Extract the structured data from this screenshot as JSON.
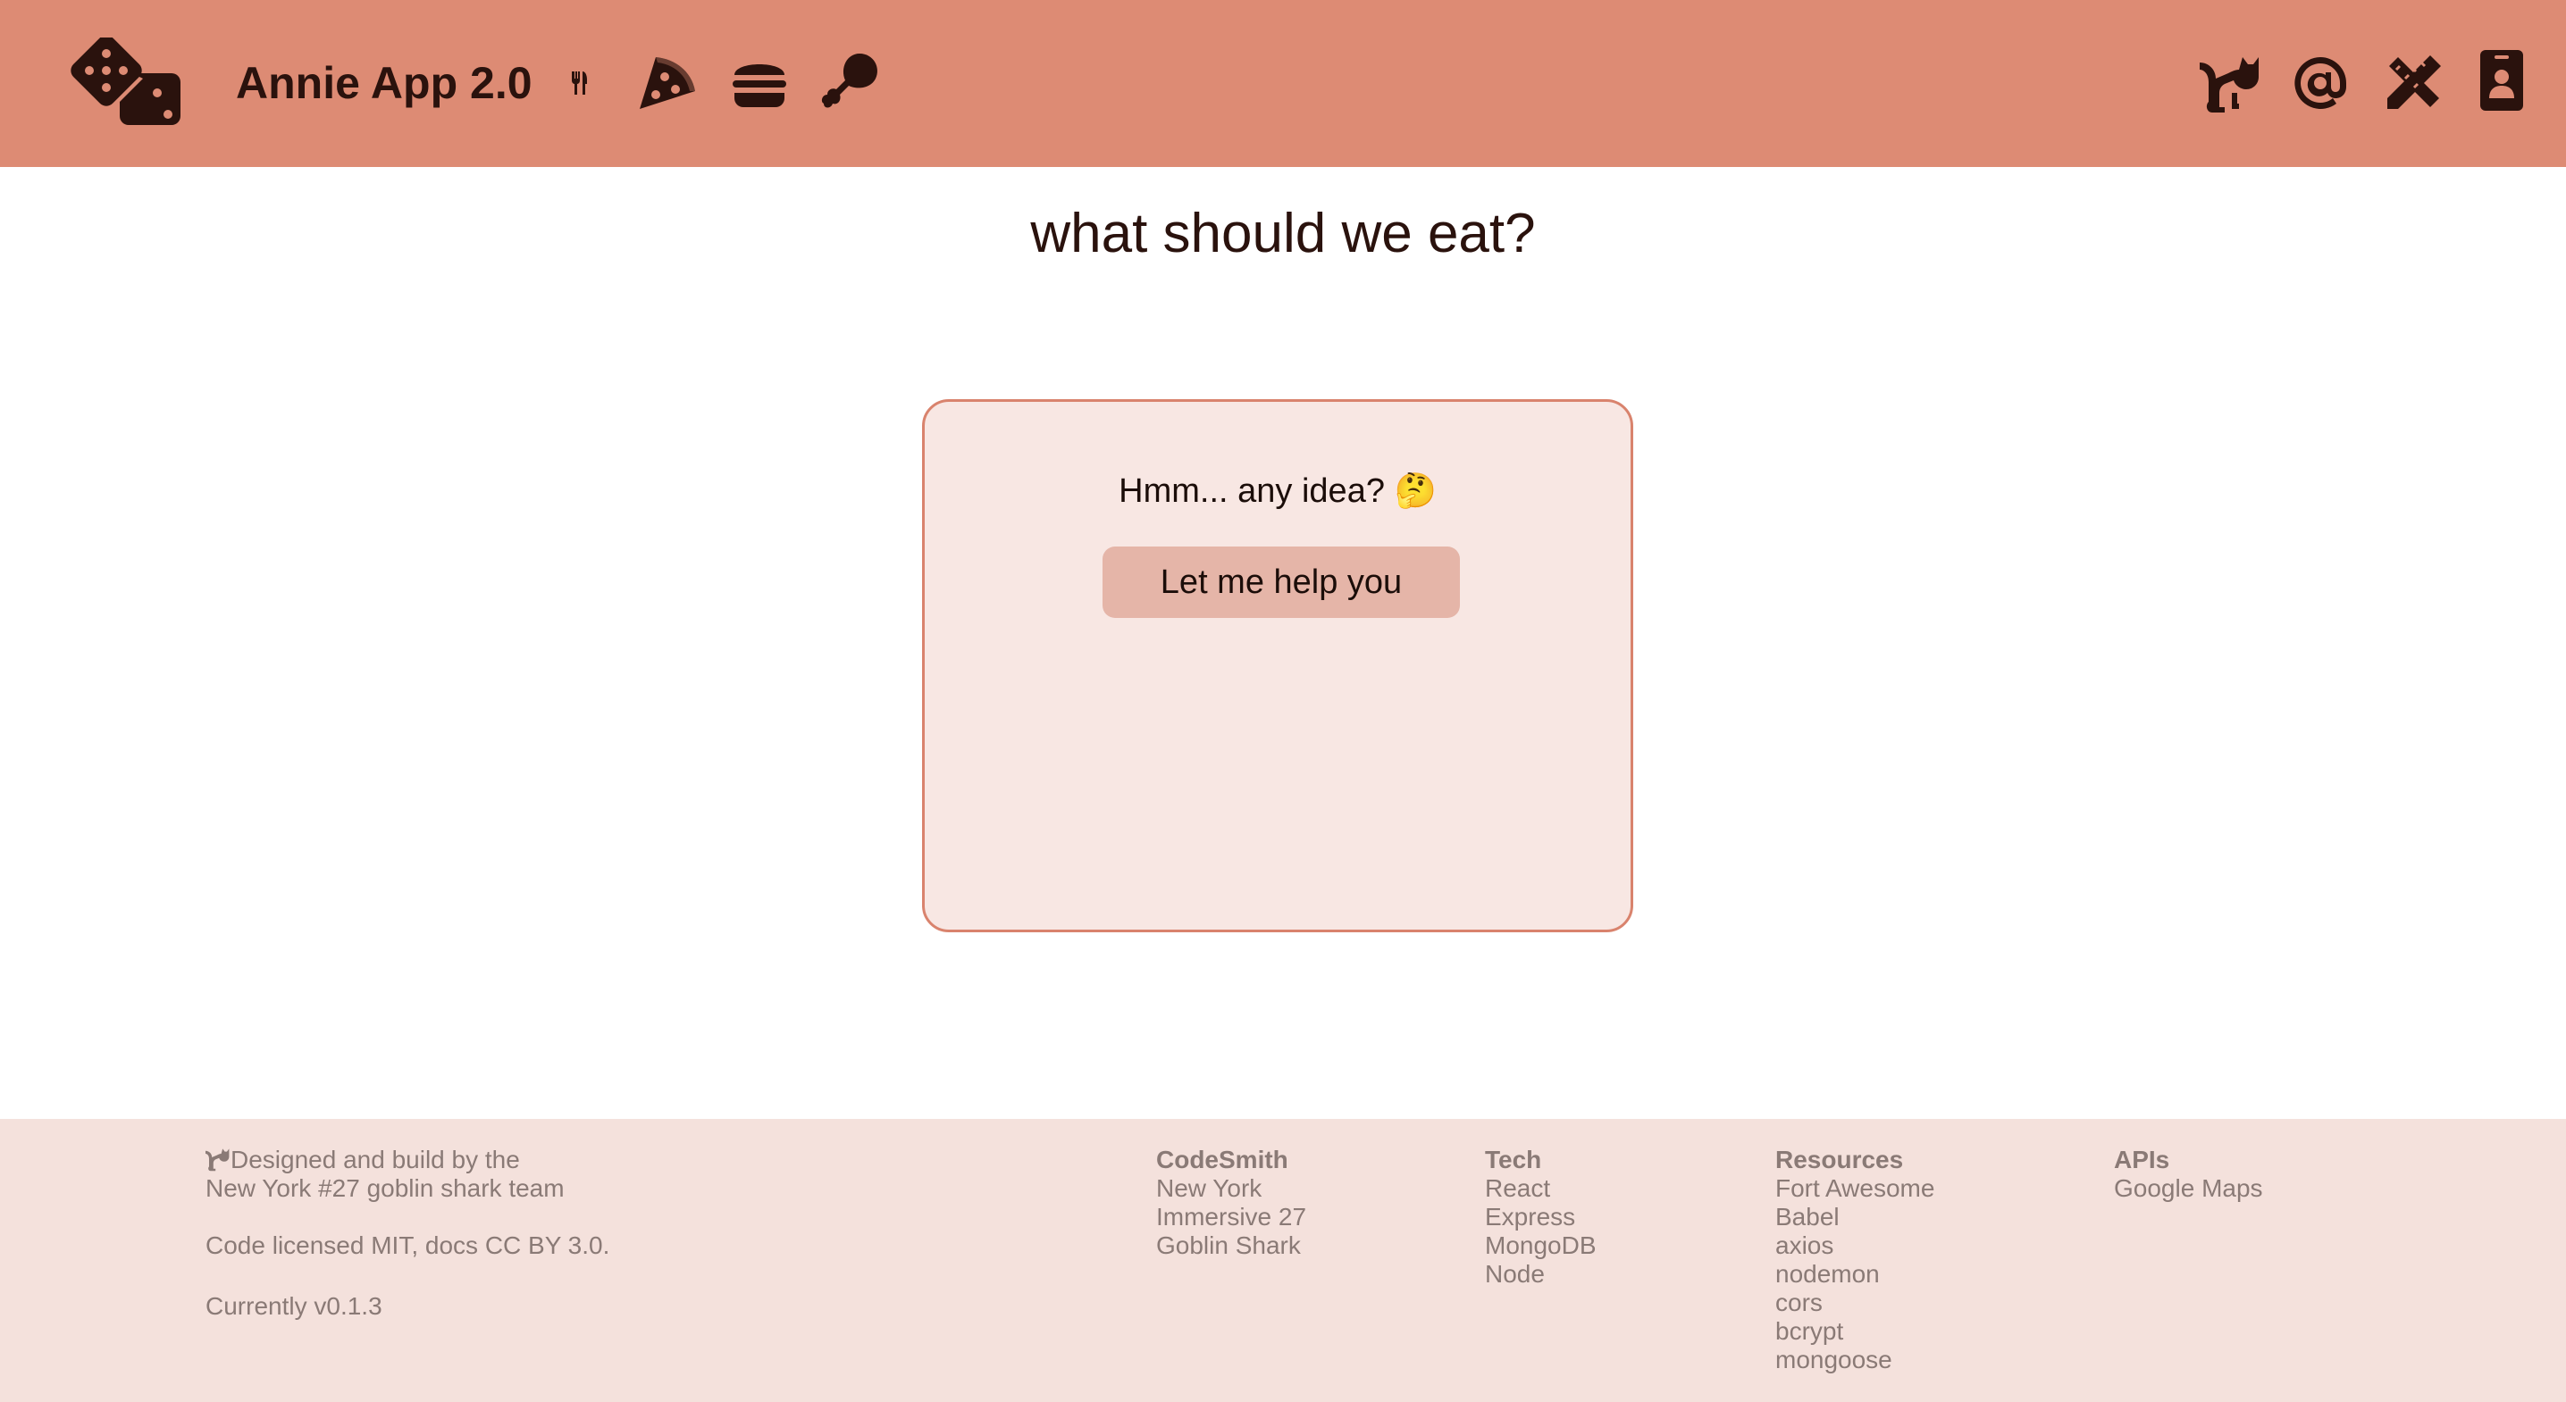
{
  "header": {
    "app_title": "Annie App 2.0",
    "nav_icons_left": [
      "utensils-icon",
      "pizza-icon",
      "burger-icon",
      "drumstick-icon"
    ],
    "nav_icons_right": [
      "cat-icon",
      "at-icon",
      "pencil-ruler-icon",
      "id-badge-icon"
    ]
  },
  "main": {
    "title": "what should we eat?",
    "card": {
      "prompt": "Hmm... any idea? 🤔",
      "button_label": "Let me help you"
    }
  },
  "footer": {
    "credits": {
      "line1": "Designed and build by the",
      "line2": "New York #27 goblin shark team",
      "license": "Code licensed MIT, docs CC BY 3.0.",
      "version": "Currently v0.1.3"
    },
    "columns": [
      {
        "heading": "CodeSmith",
        "items": [
          "New York",
          "Immersive 27",
          "Goblin Shark"
        ]
      },
      {
        "heading": "Tech",
        "items": [
          "React",
          "Express",
          "MongoDB",
          "Node"
        ]
      },
      {
        "heading": "Resources",
        "items": [
          "Fort Awesome",
          "Babel",
          "axios",
          "nodemon",
          "cors",
          "bcrypt",
          "mongoose"
        ]
      },
      {
        "heading": "APIs",
        "items": [
          "Google Maps"
        ]
      }
    ]
  },
  "colors": {
    "header_bg": "#dd8b74",
    "icon_dark": "#2a120d",
    "card_bg": "#f8e7e3",
    "card_border": "#d9836d",
    "button_bg": "#e5b5a8",
    "footer_bg": "#f4e1dc",
    "footer_text": "#8a7a76"
  }
}
